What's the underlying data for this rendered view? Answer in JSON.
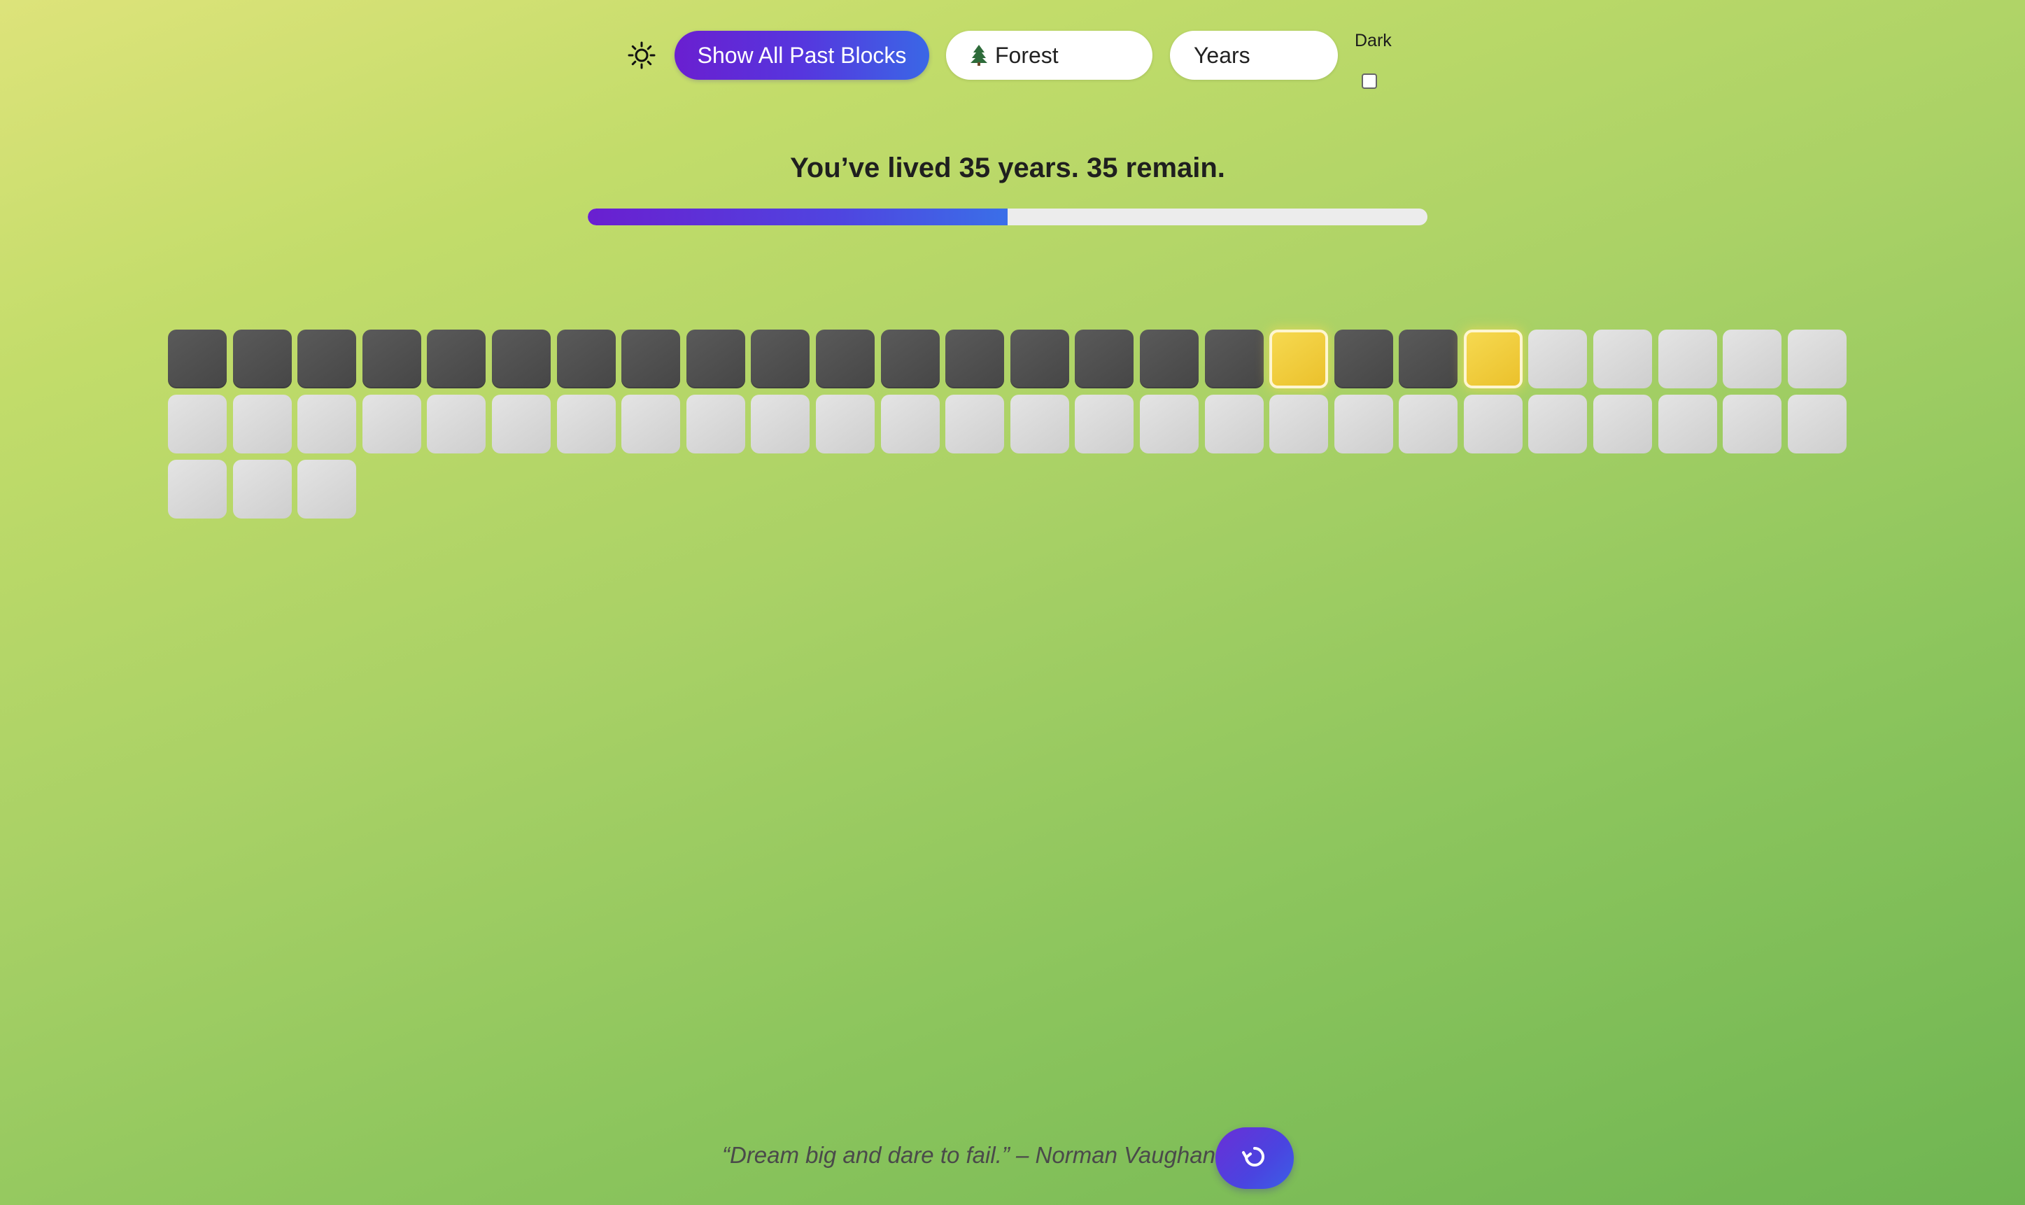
{
  "toolbar": {
    "theme_toggle_icon": "sun-icon",
    "show_past_label": "Show All Past Blocks",
    "theme_select": {
      "icon": "evergreen-tree-icon",
      "value": "Forest"
    },
    "unit_select": {
      "value": "Years"
    },
    "dark_label": "Dark",
    "dark_checked": false
  },
  "summary": {
    "text": "You’ve lived 35 years. 35 remain.",
    "progress_fraction": 0.5
  },
  "grid": {
    "total": 55,
    "blocks": [
      "lived",
      "lived",
      "lived",
      "lived",
      "lived",
      "lived",
      "lived",
      "lived",
      "lived",
      "lived",
      "lived",
      "lived",
      "lived",
      "lived",
      "lived",
      "lived",
      "lived",
      "highlight",
      "lived",
      "lived",
      "highlight",
      "future",
      "future",
      "future",
      "future",
      "future",
      "future",
      "future",
      "future",
      "future",
      "future",
      "future",
      "future",
      "future",
      "future",
      "future",
      "future",
      "future",
      "future",
      "future",
      "future",
      "future",
      "future",
      "future",
      "future",
      "future",
      "future",
      "future",
      "future",
      "future",
      "future",
      "future",
      "future",
      "future",
      "future"
    ]
  },
  "footer": {
    "quote": "“Dream big and dare to fail.” – Norman Vaughan",
    "fab_icon": "refresh-icon"
  },
  "colors": {
    "accent_start": "#6a1fd0",
    "accent_end": "#3a67e6",
    "lived": "#4f4f4f",
    "future": "#d8d8d8",
    "highlight": "#f2cf3e"
  }
}
